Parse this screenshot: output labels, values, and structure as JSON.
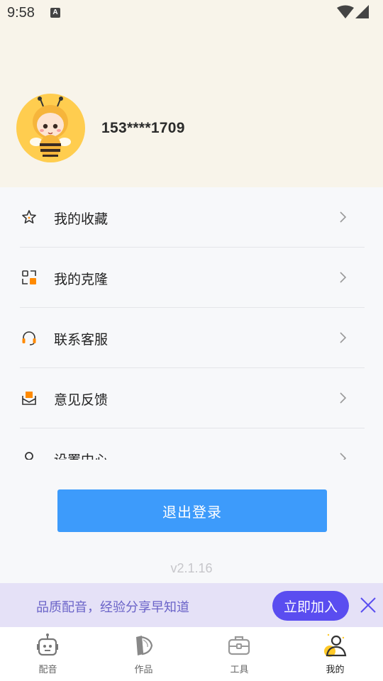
{
  "status_bar": {
    "time": "9:58",
    "notification_badge": "A"
  },
  "profile": {
    "phone": "153****1709",
    "avatar_bg": "#ffcd4f"
  },
  "menu": {
    "items": [
      {
        "label": "我的收藏",
        "icon": "star-icon"
      },
      {
        "label": "我的克隆",
        "icon": "clone-icon"
      },
      {
        "label": "联系客服",
        "icon": "headset-icon"
      },
      {
        "label": "意见反馈",
        "icon": "feedback-mail-icon"
      },
      {
        "label": "设置中心",
        "icon": "settings-icon"
      }
    ]
  },
  "logout_label": "退出登录",
  "version": "v2.1.16",
  "banner": {
    "text": "品质配音，经验分享早知道",
    "join_label": "立即加入"
  },
  "tabs": [
    {
      "label": "配音",
      "icon": "robot-icon",
      "active": false
    },
    {
      "label": "作品",
      "icon": "works-icon",
      "active": false
    },
    {
      "label": "工具",
      "icon": "toolbox-icon",
      "active": false
    },
    {
      "label": "我的",
      "icon": "user-icon",
      "active": true
    }
  ],
  "colors": {
    "header_bg": "#f8f4ea",
    "primary_button": "#3d9bfb",
    "banner_bg": "#e5e1f7",
    "banner_button": "#5a4df0",
    "accent_orange": "#ff8a00",
    "tab_active_yellow": "#ffc928"
  }
}
